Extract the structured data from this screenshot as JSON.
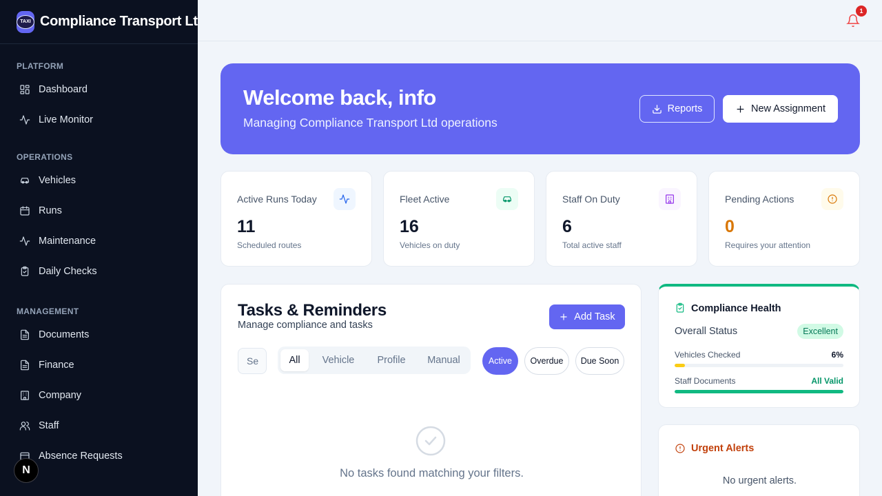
{
  "app": {
    "brand": "Compliance Transport Ltd",
    "logo_text": "TAXI",
    "dev_badge": "N"
  },
  "sidebar": {
    "sections": [
      {
        "label": "PLATFORM",
        "items": [
          {
            "label": "Dashboard",
            "icon": "dashboard-icon"
          },
          {
            "label": "Live Monitor",
            "icon": "activity-icon"
          }
        ]
      },
      {
        "label": "OPERATIONS",
        "items": [
          {
            "label": "Vehicles",
            "icon": "car-icon"
          },
          {
            "label": "Runs",
            "icon": "calendar-icon"
          },
          {
            "label": "Maintenance",
            "icon": "activity-icon"
          },
          {
            "label": "Daily Checks",
            "icon": "clipboard-check-icon"
          }
        ]
      },
      {
        "label": "MANAGEMENT",
        "items": [
          {
            "label": "Documents",
            "icon": "file-icon"
          },
          {
            "label": "Finance",
            "icon": "file-icon"
          },
          {
            "label": "Company",
            "icon": "building-icon"
          },
          {
            "label": "Staff",
            "icon": "users-icon"
          },
          {
            "label": "Absence Requests",
            "icon": "calendar-icon"
          }
        ]
      }
    ]
  },
  "topbar": {
    "notification_count": "1"
  },
  "hero": {
    "title": "Welcome back, info",
    "subtitle": "Managing Compliance Transport Ltd operations",
    "reports_label": "Reports",
    "new_assignment_label": "New Assignment",
    "bg_color": "#6366f1"
  },
  "stats": [
    {
      "label": "Active Runs Today",
      "value": "11",
      "sub": "Scheduled routes",
      "icon": "activity-icon",
      "icon_color": "#2563eb",
      "icon_bg": "#eff6ff"
    },
    {
      "label": "Fleet Active",
      "value": "16",
      "sub": "Vehicles on duty",
      "icon": "car-icon",
      "icon_color": "#059669",
      "icon_bg": "#ecfdf5"
    },
    {
      "label": "Staff On Duty",
      "value": "6",
      "sub": "Total active staff",
      "icon": "building-icon",
      "icon_color": "#9333ea",
      "icon_bg": "#faf5ff"
    },
    {
      "label": "Pending Actions",
      "value": "0",
      "sub": "Requires your attention",
      "icon": "alert-circle-icon",
      "icon_color": "#d97706",
      "icon_bg": "#fffbeb",
      "value_color": "#d97706"
    }
  ],
  "tasks": {
    "title": "Tasks & Reminders",
    "subtitle": "Manage compliance and tasks",
    "add_label": "Add Task",
    "search_placeholder": "Search",
    "search_visible": "Se",
    "tabs": [
      "All",
      "Vehicle",
      "Profile",
      "Manual"
    ],
    "active_tab": "All",
    "filters": [
      "Active",
      "Overdue",
      "Due Soon"
    ],
    "active_filter": "Active",
    "empty_text": "No tasks found matching your filters."
  },
  "health": {
    "title": "Compliance Health",
    "overall_label": "Overall Status",
    "overall_value": "Excellent",
    "rows": [
      {
        "label": "Vehicles Checked",
        "value": "6%",
        "fraction": 0.06,
        "color": "#facc15",
        "value_color": "#0f172a"
      },
      {
        "label": "Staff Documents",
        "value": "All Valid",
        "fraction": 1.0,
        "color": "#10b981",
        "value_color": "#059669"
      }
    ]
  },
  "alerts": {
    "title": "Urgent Alerts",
    "empty_text": "No urgent alerts."
  }
}
